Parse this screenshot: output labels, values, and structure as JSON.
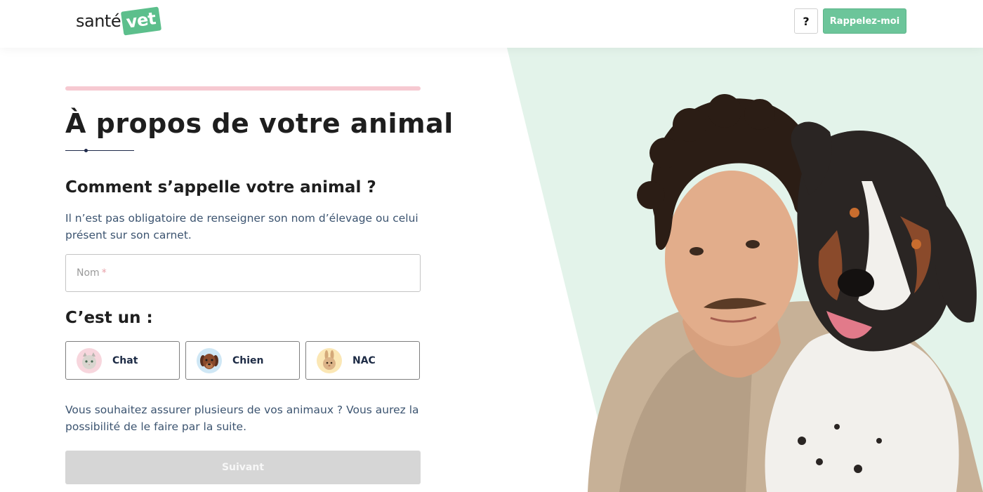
{
  "header": {
    "logo_text": "santé",
    "logo_badge": "vet",
    "help_label": "?",
    "callback_label": "Rappelez-moi"
  },
  "form": {
    "title": "À propos de votre animal",
    "question_name": "Comment s’appelle votre animal ?",
    "name_help": "Il n’est pas obligatoire de renseigner son nom d’élevage ou celui présent sur son carnet.",
    "name_placeholder": "Nom",
    "required_mark": "*",
    "question_type": "C’est un :",
    "choices": [
      {
        "label": "Chat",
        "icon": "cat-photo-icon"
      },
      {
        "label": "Chien",
        "icon": "dog-photo-icon"
      },
      {
        "label": "NAC",
        "icon": "rabbit-photo-icon"
      }
    ],
    "multi_pet_note": "Vous souhaitez assurer plusieurs de vos animaux ? Vous aurez la possibilité de le faire par la suite.",
    "next_label": "Suivant"
  },
  "colors": {
    "brand_green": "#6cc59a",
    "progress_pink": "#f6c9d1",
    "hero_bg": "#e3f3ea",
    "text_blue": "#3c5470",
    "disabled_button": "#d6d6d6"
  },
  "progress": 1.0
}
